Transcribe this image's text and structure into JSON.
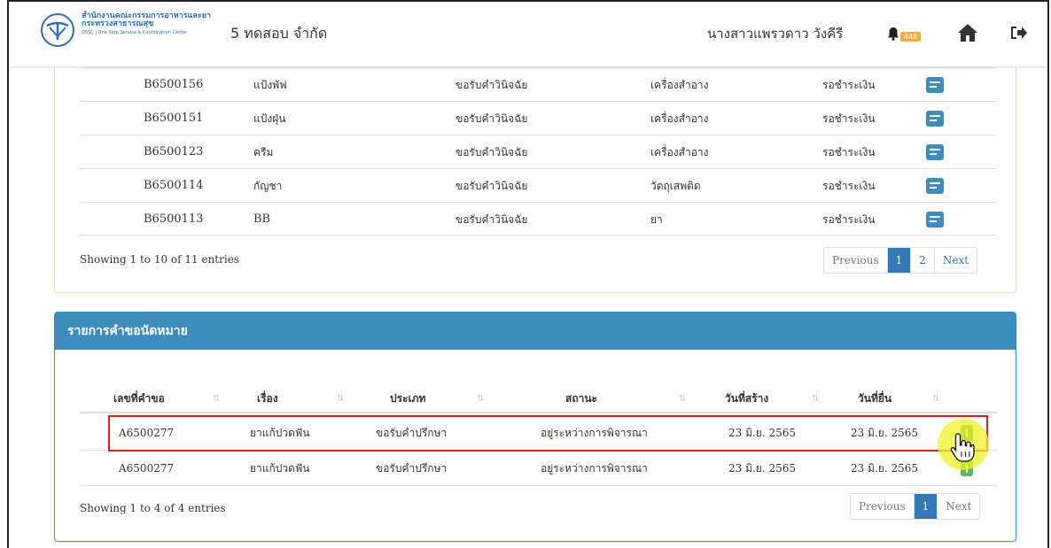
{
  "header": {
    "org_line1": "สำนักงานคณะกรรมการอาหารและยา",
    "org_line2": "กระทรวงสาธารณสุข",
    "org_line3": "OSSC | One Stop Service & Coordination Center",
    "company": "5 ทดสอบ จำกัด",
    "user_name": "นางสาวแพรวดาว วังคีรี",
    "notification_count": "448",
    "colors": {
      "brand": "#2b6fae",
      "badge": "#f0ad4e"
    },
    "icons": [
      "bell-icon",
      "home-icon",
      "logout-icon"
    ]
  },
  "requests_table": {
    "rows": [
      {
        "id": "B6500156",
        "name": "แป้งพัฟ",
        "type": "ขอรับคำวินิจฉัย",
        "category": "เครื่องสำอาง",
        "status": "รอชำระเงิน"
      },
      {
        "id": "B6500151",
        "name": "แป้งฝุ่น",
        "type": "ขอรับคำวินิจฉัย",
        "category": "เครื่องสำอาง",
        "status": "รอชำระเงิน"
      },
      {
        "id": "B6500123",
        "name": "ครีม",
        "type": "ขอรับคำวินิจฉัย",
        "category": "เครื่องสำอาง",
        "status": "รอชำระเงิน"
      },
      {
        "id": "B6500114",
        "name": "กัญชา",
        "type": "ขอรับคำวินิจฉัย",
        "category": "วัตถุเสพติด",
        "status": "รอชำระเงิน"
      },
      {
        "id": "B6500113",
        "name": "BB",
        "type": "ขอรับคำวินิจฉัย",
        "category": "ยา",
        "status": "รอชำระเงิน"
      }
    ],
    "info": "Showing 1 to 10 of 11 entries",
    "pagination": {
      "previous": "Previous",
      "pages": [
        "1",
        "2"
      ],
      "active_page": "1",
      "next": "Next"
    }
  },
  "appointments": {
    "title": "รายการคำขอนัดหมาย",
    "headers": [
      "เลขที่คำขอ",
      "เรื่อง",
      "ประเภท",
      "สถานะ",
      "วันที่สร้าง",
      "วันที่ยื่น"
    ],
    "rows": [
      {
        "id": "A6500277",
        "subject": "ยาแก้ปวดฟัน",
        "type": "ขอรับคำปรึกษา",
        "status": "อยู่ระหว่างการพิจารณา",
        "created": "23 มิ.ย. 2565",
        "submitted": "23 มิ.ย. 2565"
      },
      {
        "id": "A6500277",
        "subject": "ยาแก้ปวดฟัน",
        "type": "ขอรับคำปรึกษา",
        "status": "อยู่ระหว่างการพิจารณา",
        "created": "23 มิ.ย. 2565",
        "submitted": "23 มิ.ย. 2565"
      }
    ],
    "info": "Showing 1 to 4 of 4 entries",
    "pagination": {
      "previous": "Previous",
      "pages": [
        "1"
      ],
      "active_page": "1",
      "next": "Next"
    },
    "colors": {
      "panel": "#3c8dbc",
      "action": "#5cb85c",
      "highlight": "#e02020"
    }
  }
}
